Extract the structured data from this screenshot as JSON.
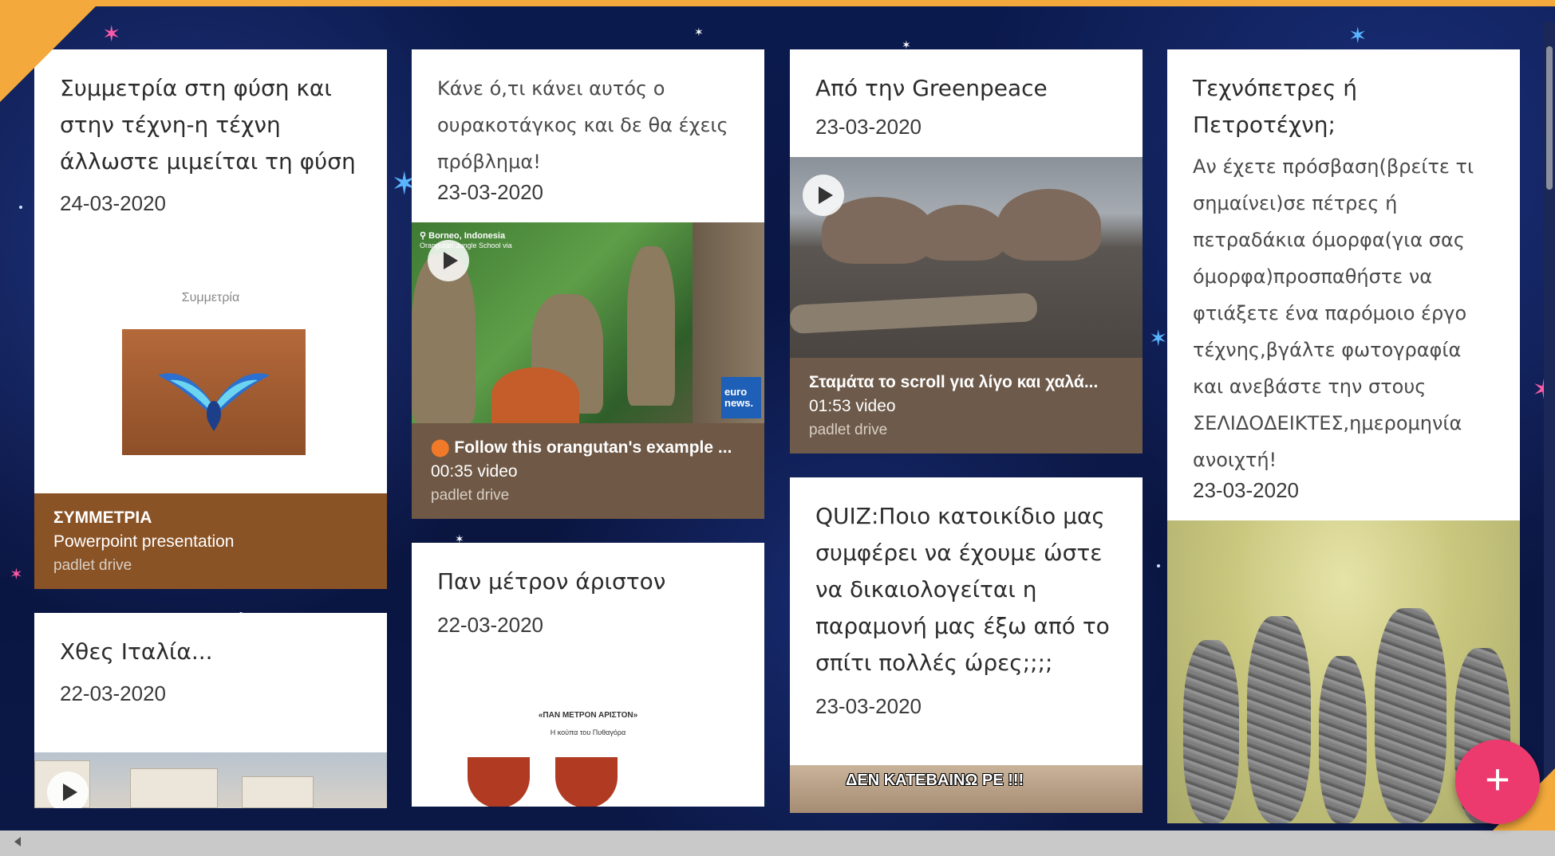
{
  "columns": [
    {
      "posts": [
        {
          "title": "Συμμετρία στη φύση και στην τέχνη-η τέχνη άλλωστε μιμείται τη φύση",
          "date": "24-03-2020",
          "preview_caption": "Συμμετρία",
          "attachment": {
            "title": "ΣΥΜΜΕΤΡΙΑ",
            "subtitle": "Powerpoint presentation",
            "provider": "padlet drive"
          }
        },
        {
          "title": "Χθες Ιταλία...",
          "date": "22-03-2020"
        }
      ]
    },
    {
      "posts": [
        {
          "text": "Κάνε ό,τι κάνει αυτός ο ουρακοτάγκος και δε θα έχεις πρόβλημα!",
          "date": "23-03-2020",
          "video_location": "Borneo, Indonesia",
          "video_location_sub": "Orangutan Jungle School via",
          "video_badge": "euro news.",
          "attachment": {
            "title": "Follow this orangutan's example ...",
            "subtitle": "00:35 video",
            "provider": "padlet drive"
          }
        },
        {
          "title": "Παν μέτρον άριστον",
          "date": "22-03-2020",
          "preview_line1": "«ΠΑΝ ΜΕΤΡΟΝ ΑΡΙΣΤΟΝ»",
          "preview_line2": "Η κούπα του Πυθαγόρα"
        }
      ]
    },
    {
      "posts": [
        {
          "title": "Από την Greenpeace",
          "date": "23-03-2020",
          "attachment": {
            "title": "Σταμάτα το scroll για λίγο και χαλά...",
            "subtitle": "01:53 video",
            "provider": "padlet drive"
          }
        },
        {
          "title": "QUIZ:Ποιο κατοικίδιο μας συμφέρει να έχουμε ώστε να δικαιολογείται η παραμονή μας έξω από το σπίτι πολλές ώρες;;;;",
          "date": "23-03-2020",
          "preview_text": "ΔΕΝ ΚΑΤΕΒΑΙΝΩ ΡΕ !!!"
        }
      ]
    },
    {
      "posts": [
        {
          "title": "Τεχνόπετρες ή Πετροτέχνη;",
          "text": "Αν έχετε πρόσβαση(βρείτε τι σημαίνει)σε πέτρες ή πετραδάκια όμορφα(για σας όμορφα)προσπαθήστε να φτιάξετε ένα παρόμοιο έργο τέχνης,βγάλτε φωτογραφία και ανεβάστε την στους ΣΕΛΙΔΟΔΕΙΚΤΕΣ,ημερομηνία ανοιχτή!",
          "date": "23-03-2020"
        }
      ]
    }
  ],
  "fab_label": "+",
  "icons": {
    "play": "play-icon",
    "add": "plus-icon",
    "pin": "location-pin-icon",
    "scroll_left": "chevron-left-icon"
  },
  "colors": {
    "accent": "#ec3a6e",
    "frame": "#f3a93b",
    "background": "#0c1740"
  }
}
